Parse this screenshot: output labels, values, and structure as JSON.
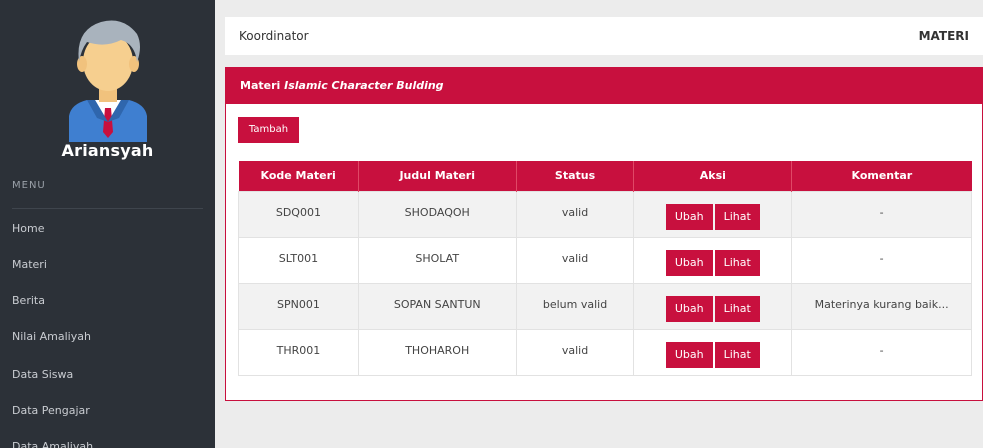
{
  "sidebar": {
    "user_name": "Ariansyah",
    "menu_title": "MENU",
    "items": [
      "Home",
      "Materi",
      "Berita",
      "Nilai Amaliyah",
      "Data Siswa",
      "Data Pengajar",
      "Data Amalivah"
    ]
  },
  "topbar": {
    "role": "Koordinator",
    "page": "MATERI"
  },
  "panel": {
    "title_prefix": "Materi",
    "title_italic": "Islamic Character Bulding",
    "add_label": "Tambah"
  },
  "table": {
    "headers": [
      "Kode Materi",
      "Judul Materi",
      "Status",
      "Aksi",
      "Komentar"
    ],
    "rows": [
      {
        "kode": "SDQ001",
        "judul": "SHODAQOH",
        "status": "valid",
        "komentar": "-"
      },
      {
        "kode": "SLT001",
        "judul": "SHOLAT",
        "status": "valid",
        "komentar": "-"
      },
      {
        "kode": "SPN001",
        "judul": "SOPAN SANTUN",
        "status": "belum valid",
        "komentar": "Materinya kurang baik..."
      },
      {
        "kode": "THR001",
        "judul": "THOHAROH",
        "status": "valid",
        "komentar": "-"
      }
    ],
    "edit_label": "Ubah",
    "view_label": "Lihat"
  },
  "colors": {
    "accent": "#c8103e",
    "sidebar_bg": "#2c3138"
  }
}
